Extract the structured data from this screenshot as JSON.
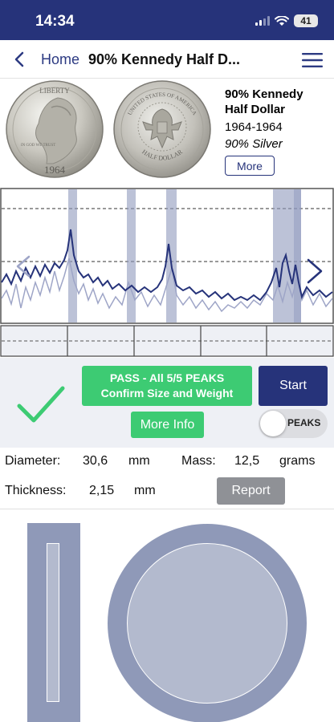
{
  "status_bar": {
    "time": "14:34",
    "battery": "41",
    "icons": [
      "cellular-signal-icon",
      "wifi-icon",
      "battery-icon"
    ]
  },
  "nav": {
    "back_icon": "chevron-left-icon",
    "home_label": "Home",
    "title": "90% Kennedy Half D...",
    "menu_icon": "hamburger-menu-icon"
  },
  "coin": {
    "name": "90% Kennedy Half Dollar",
    "years": "1964-1964",
    "composition": "90% Silver",
    "more_label": "More",
    "obverse_text": {
      "liberty": "LIBERTY",
      "motto": "IN GOD WE TRUST",
      "year": "1964"
    },
    "reverse_text": {
      "legend": "UNITED STATES OF AMERICA",
      "denomination": "HALF DOLLAR"
    }
  },
  "spectrum": {
    "peak_markers": 5,
    "nav_icons": [
      "chevron-left-icon",
      "chevron-right-icon"
    ],
    "colors": {
      "measured": "#26337a",
      "reference": "#9ea5c7",
      "band": "#8f99bd"
    }
  },
  "result": {
    "pass_line1": "PASS - All 5/5 PEAKS",
    "pass_line2": "Confirm Size and Weight",
    "start_label": "Start",
    "more_info_label": "More Info",
    "peaks_toggle_label": "PEAKS",
    "peaks_toggle_on": false,
    "check_icon": "checkmark-icon"
  },
  "measurements": {
    "diameter_label": "Diameter:",
    "diameter_value": "30,6",
    "diameter_unit": "mm",
    "mass_label": "Mass:",
    "mass_value": "12,5",
    "mass_unit": "grams",
    "thickness_label": "Thickness:",
    "thickness_value": "2,15",
    "thickness_unit": "mm",
    "report_label": "Report"
  },
  "colors": {
    "primary": "#26337a",
    "success": "#3dcb73",
    "disabled": "#8f9196",
    "shape_fill": "#8f99b8"
  }
}
